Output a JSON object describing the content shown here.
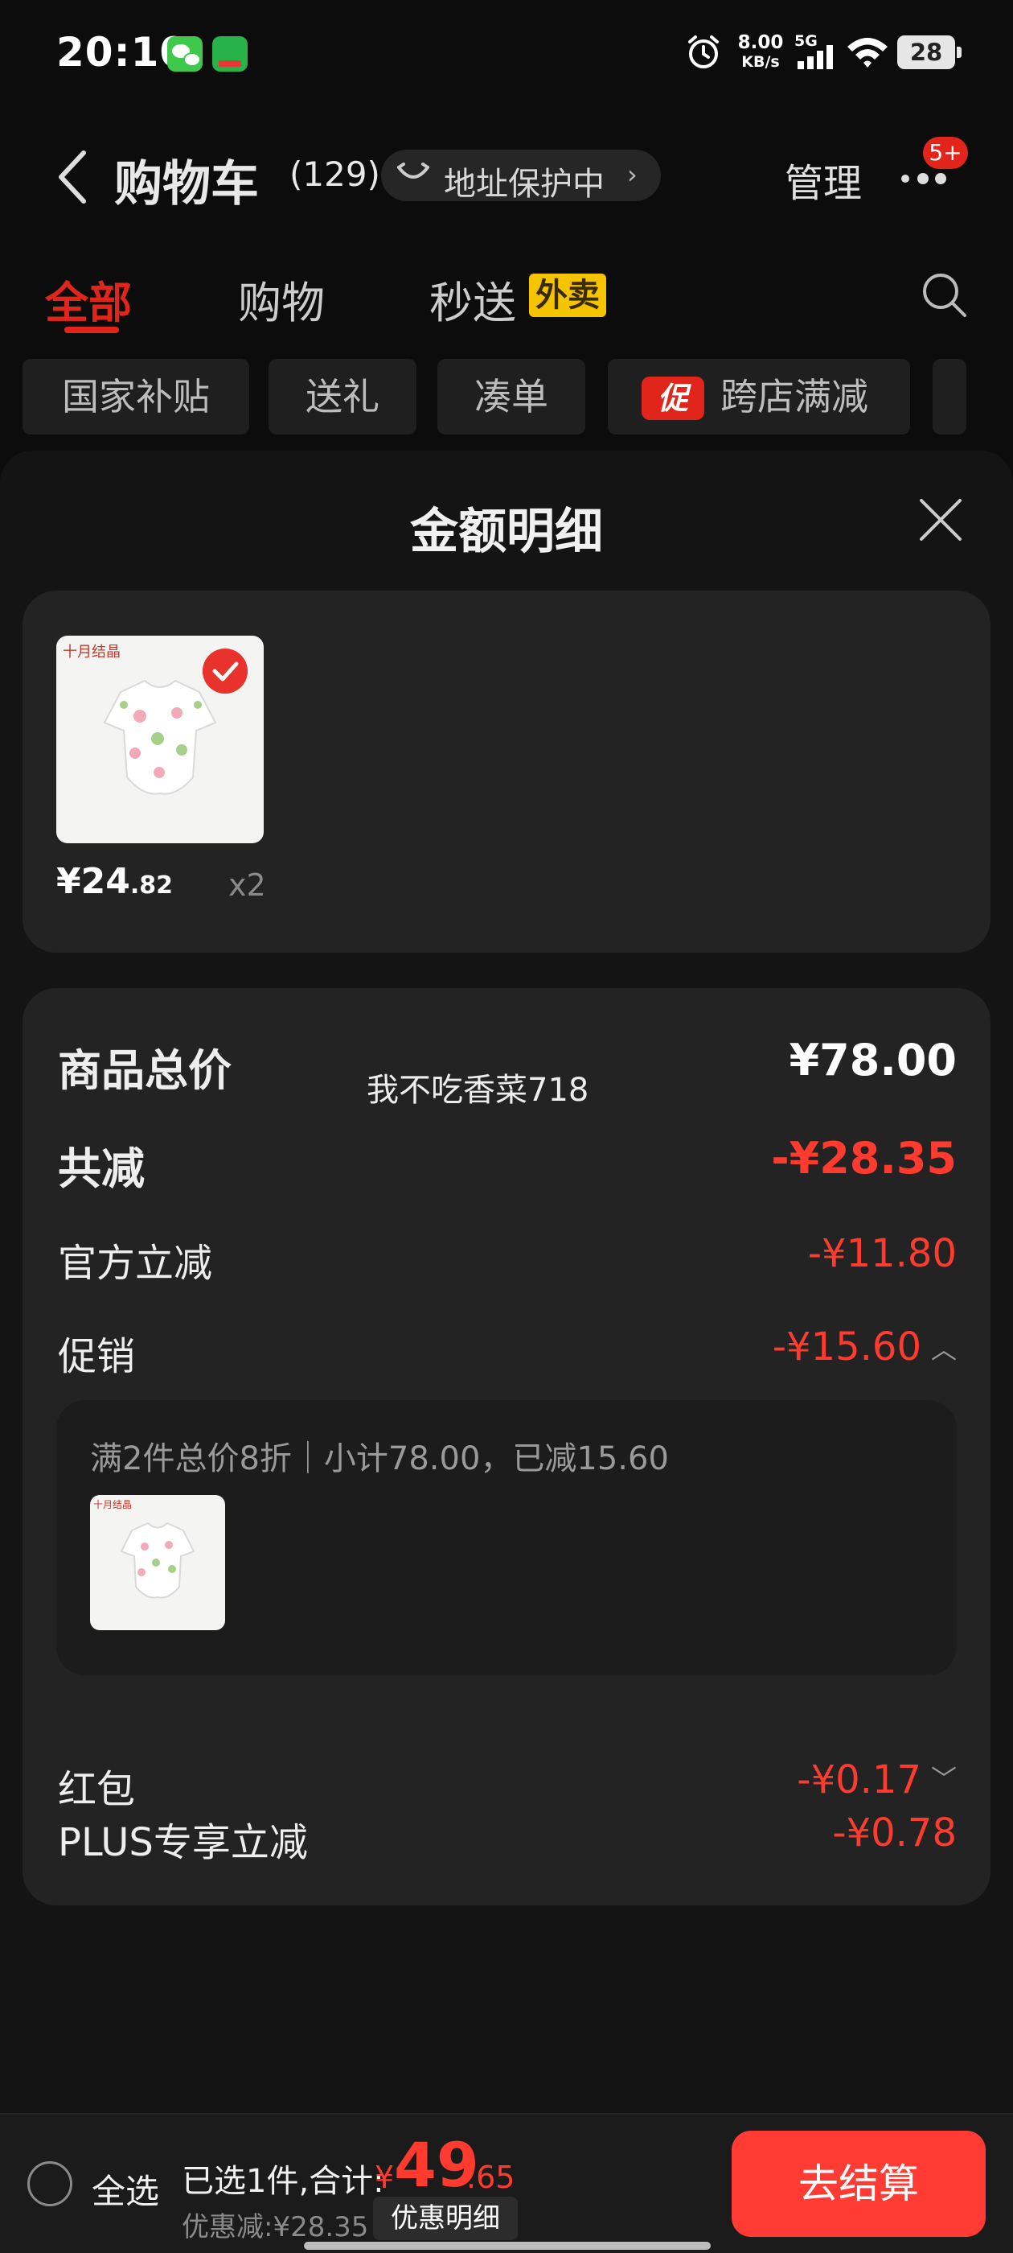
{
  "status_bar": {
    "time": "20:10",
    "net_speed": "8.00",
    "net_speed_unit": "KB/s",
    "network": "5G",
    "battery": "28",
    "icons": [
      "wechat-icon",
      "app-icon",
      "alarm-icon",
      "signal-icon",
      "wifi-icon",
      "battery-icon"
    ]
  },
  "header": {
    "title": "购物车",
    "count": "(129)",
    "address_protection": "地址保护中",
    "address_chevron": "›",
    "manage": "管理",
    "badge": "5+"
  },
  "tabs": [
    {
      "label": "全部",
      "active": true
    },
    {
      "label": "购物",
      "active": false
    },
    {
      "label": "秒送",
      "active": false,
      "badge": "外卖"
    }
  ],
  "filters": [
    {
      "label": "国家补贴"
    },
    {
      "label": "送礼"
    },
    {
      "label": "凑单"
    },
    {
      "label": "跨店满减",
      "tag": "促"
    }
  ],
  "sheet": {
    "title": "金额明细",
    "product": {
      "brand_text": "十月结晶",
      "price_int": "¥24",
      "price_dec": ".82",
      "quantity": "x2"
    },
    "watermark": "我不吃香菜718",
    "rows": {
      "total_label": "商品总价",
      "total_value": "¥78.00",
      "reduce_label": "共减",
      "reduce_value": "-¥28.35",
      "official_label": "官方立减",
      "official_value": "-¥11.80",
      "promo_label": "促销",
      "promo_value": "-¥15.60",
      "promo_caret": "︿",
      "promo_detail": "满2件总价8折｜小计78.00，已减15.60",
      "redpacket_label": "红包",
      "redpacket_value": "-¥0.17",
      "redpacket_caret": "﹀",
      "plus_label": "PLUS专享立减",
      "plus_value": "-¥0.78"
    }
  },
  "bottom_bar": {
    "select_all": "全选",
    "selected_summary": "已选1件,合计:",
    "total_currency": "¥",
    "total_int": "49",
    "total_dec": ".65",
    "discount_summary": "优惠减:¥28.35",
    "detail_toggle": "优惠明细",
    "checkout": "去结算"
  },
  "colors": {
    "accent": "#e1251b",
    "price_red": "#ff3b2f",
    "badge_yellow": "#f5c400",
    "background": "#0c0c0c",
    "card": "#232323"
  }
}
